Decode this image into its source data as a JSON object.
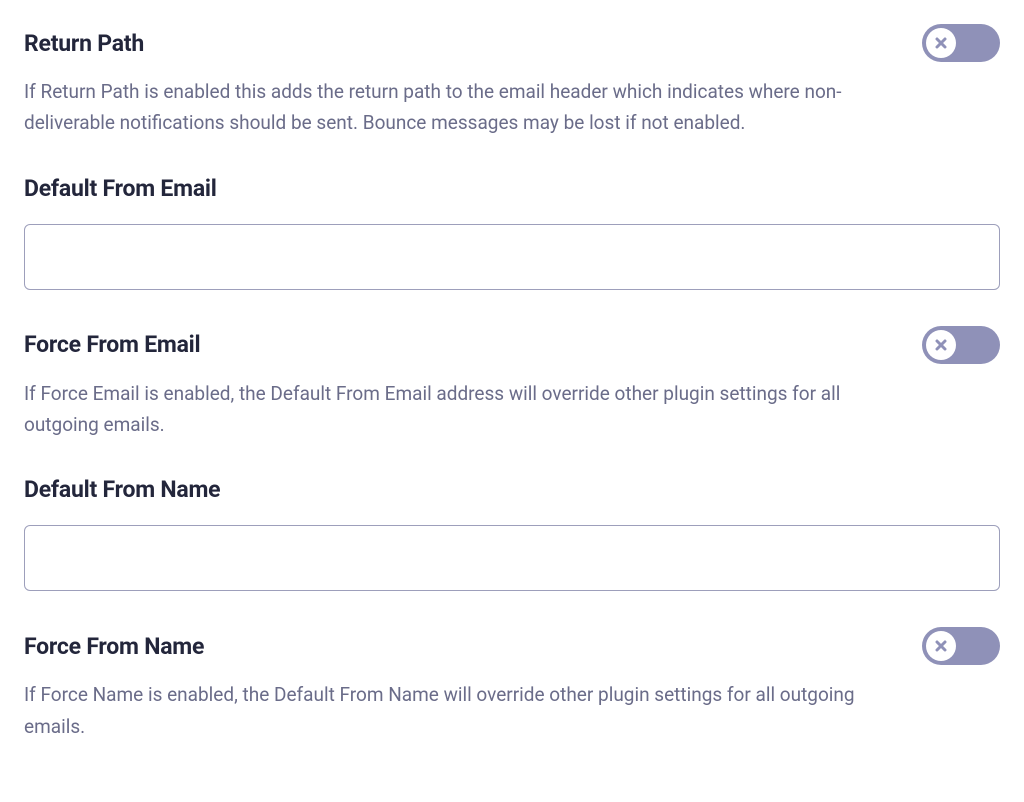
{
  "return_path": {
    "title": "Return Path",
    "desc": "If Return Path is enabled this adds the return path to the email header which indicates where non-deliverable notifications should be sent. Bounce messages may be lost if not enabled.",
    "enabled": false
  },
  "default_from_email": {
    "title": "Default From Email",
    "value": "",
    "placeholder": ""
  },
  "force_from_email": {
    "title": "Force From Email",
    "desc": "If Force Email is enabled, the Default From Email address will override other plugin settings for all outgoing emails.",
    "enabled": false
  },
  "default_from_name": {
    "title": "Default From Name",
    "value": "",
    "placeholder": ""
  },
  "force_from_name": {
    "title": "Force From Name",
    "desc": "If Force Name is enabled, the Default From Name will override other plugin settings for all outgoing emails.",
    "enabled": false
  }
}
